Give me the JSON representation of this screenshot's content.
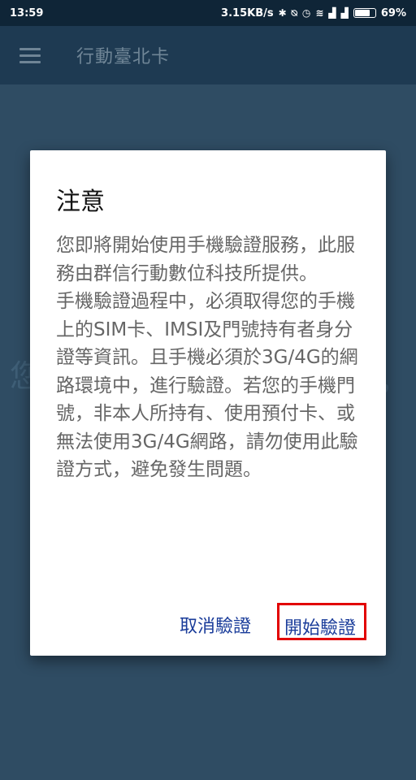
{
  "status_bar": {
    "time": "13:59",
    "speed": "3.15KB/s",
    "battery": "69%",
    "battery_level": 0.69,
    "icons": [
      "bluetooth-icon",
      "mute-icon",
      "alarm-icon",
      "wifi-icon",
      "signal-icon",
      "signal-icon",
      "battery-icon"
    ]
  },
  "app_bar": {
    "title": "行動臺北卡",
    "menu_icon": "hamburger-menu-icon"
  },
  "background": {
    "left_char": "您",
    "right_char": "，"
  },
  "dialog": {
    "title": "注意",
    "body": "您即將開始使用手機驗證服務，此服務由群信行動數位科技所提供。\n手機驗證過程中，必須取得您的手機上的SIM卡、IMSI及門號持有者身分證等資訊。且手機必須於3G/4G的網路環境中，進行驗證。若您的手機門號，非本人所持有、使用預付卡、或無法使用3G/4G網路，請勿使用此驗證方式，避免發生問題。",
    "cancel_label": "取消驗證",
    "start_label": "開始驗證",
    "highlight_color": "#e20000",
    "button_color": "#1a3c9a"
  }
}
